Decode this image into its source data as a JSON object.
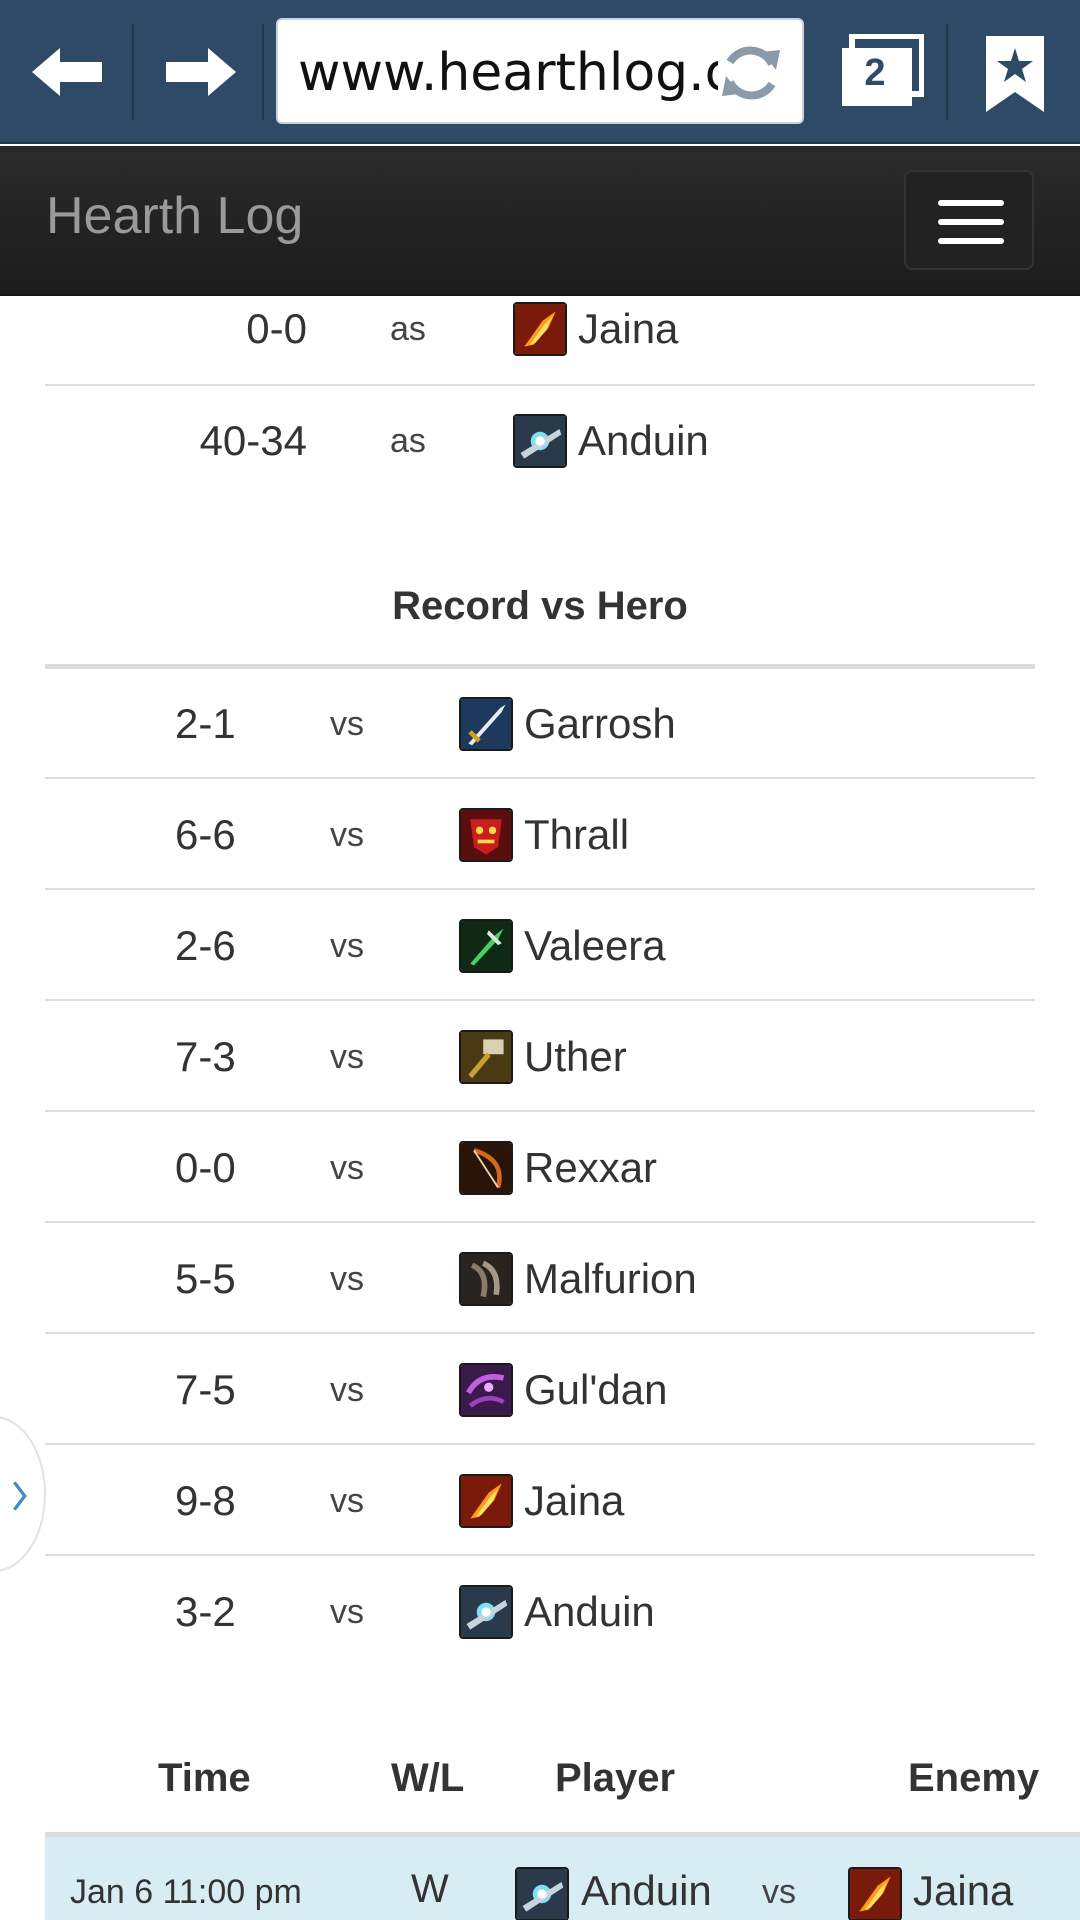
{
  "browser": {
    "url": "www.hearthlog.com",
    "tab_count": "2"
  },
  "header": {
    "brand": "Hearth Log"
  },
  "record_as_hero": {
    "rows": [
      {
        "record": "0-0",
        "word": "as",
        "hero": "Jaina",
        "icon": "mage-fire-icon"
      },
      {
        "record": "40-34",
        "word": "as",
        "hero": "Anduin",
        "icon": "priest-icon"
      }
    ]
  },
  "record_vs_hero": {
    "title": "Record vs Hero",
    "rows": [
      {
        "record": "2-1",
        "word": "vs",
        "hero": "Garrosh",
        "icon": "warrior-sword-icon"
      },
      {
        "record": "6-6",
        "word": "vs",
        "hero": "Thrall",
        "icon": "shaman-icon"
      },
      {
        "record": "2-6",
        "word": "vs",
        "hero": "Valeera",
        "icon": "rogue-dagger-icon"
      },
      {
        "record": "7-3",
        "word": "vs",
        "hero": "Uther",
        "icon": "paladin-hammer-icon"
      },
      {
        "record": "0-0",
        "word": "vs",
        "hero": "Rexxar",
        "icon": "hunter-bow-icon"
      },
      {
        "record": "5-5",
        "word": "vs",
        "hero": "Malfurion",
        "icon": "druid-claw-icon"
      },
      {
        "record": "7-5",
        "word": "vs",
        "hero": "Gul'dan",
        "icon": "warlock-icon"
      },
      {
        "record": "9-8",
        "word": "vs",
        "hero": "Jaina",
        "icon": "mage-fire-icon"
      },
      {
        "record": "3-2",
        "word": "vs",
        "hero": "Anduin",
        "icon": "priest-icon"
      }
    ]
  },
  "games_table": {
    "headers": {
      "time": "Time",
      "wl": "W/L",
      "player": "Player",
      "enemy": "Enemy"
    },
    "rows": [
      {
        "time": "Jan 6 11:00 pm",
        "wl": "W",
        "player": "Anduin",
        "vs": "vs",
        "enemy": "Jaina"
      }
    ]
  },
  "colors": {
    "browser_bar": "#2f4a66",
    "app_header": "#222222",
    "row_highlight": "#d8ecf4",
    "divider": "#dddddd",
    "side_arrow": "#3a8fb7"
  }
}
